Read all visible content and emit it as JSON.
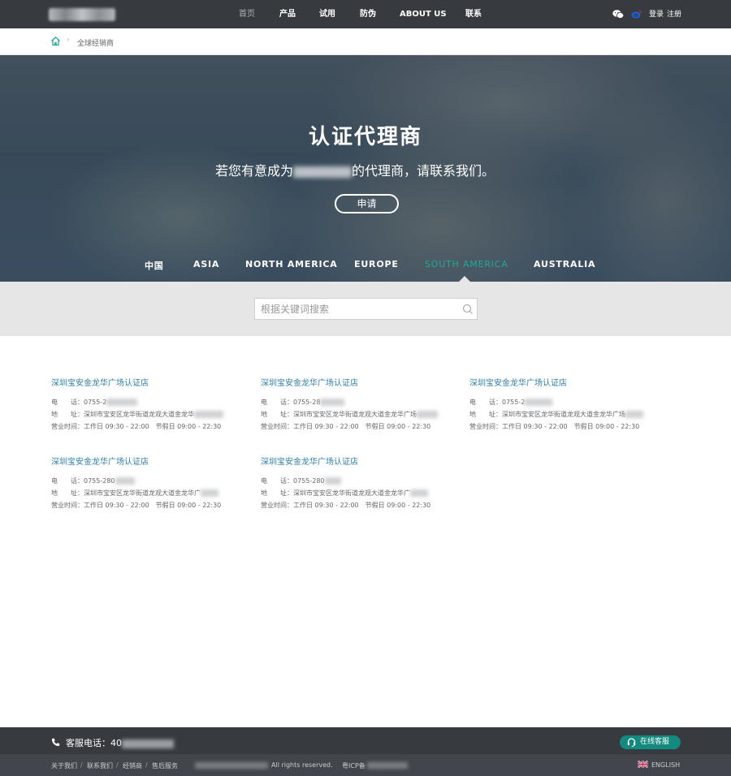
{
  "colors": {
    "topbar": "#373b40",
    "accent": "#1fa89a",
    "link": "#2e7ea6",
    "online_button": "#138a80"
  },
  "nav": {
    "items": [
      "首页",
      "产品",
      "试用",
      "防伪",
      "ABOUT US",
      "联系"
    ],
    "login": "登录",
    "register": "注册",
    "icons": [
      "wechat-icon",
      "weibo-icon"
    ]
  },
  "breadcrumb": {
    "current": "全球经销商",
    "icon": "home-icon"
  },
  "hero": {
    "title": "认证代理商",
    "subtitle_prefix": "若您有意成为",
    "subtitle_suffix": "的代理商，请联系我们。",
    "apply": "申请",
    "regions": [
      "中国",
      "ASIA",
      "NORTH AMERICA",
      "EUROPE",
      "SOUTH AMERICA",
      "AUSTRALIA"
    ],
    "active_region": "SOUTH AMERICA"
  },
  "search": {
    "placeholder": "根据关键词搜索",
    "value": ""
  },
  "dealers": [
    {
      "name": "深圳宝安金龙华广场认证店",
      "phone_label": "电　　话：",
      "phone": "0755-2",
      "addr_label": "地　　址：",
      "address": "深圳市宝安区龙华街道龙观大道金龙华",
      "hours_label": "营业时间：",
      "hours": "工作日 09:30 - 22:00　节假日 09:00 - 22:30"
    },
    {
      "name": "深圳宝安金龙华广场认证店",
      "phone_label": "电　　话：",
      "phone": "0755-28",
      "addr_label": "地　　址：",
      "address": "深圳市宝安区龙华街道龙观大道金龙华广场",
      "hours_label": "营业时间：",
      "hours": "工作日 09:30 - 22:00　节假日 09:00 - 22:30"
    },
    {
      "name": "深圳宝安金龙华广场认证店",
      "phone_label": "电　　话：",
      "phone": "0755-2",
      "addr_label": "地　　址：",
      "address": "深圳市宝安区龙华街道龙观大道金龙华广场",
      "hours_label": "营业时间：",
      "hours": "工作日 09:30 - 22:00　节假日 09:00 - 22:30"
    },
    {
      "name": "深圳宝安金龙华广场认证店",
      "phone_label": "电　　话：",
      "phone": "0755-280",
      "addr_label": "地　　址：",
      "address": "深圳市宝安区龙华街道龙观大道金龙华广",
      "hours_label": "营业时间：",
      "hours": "工作日 09:30 - 22:00　节假日 09:00 - 22:30"
    },
    {
      "name": "深圳宝安金龙华广场认证店",
      "phone_label": "电　　话：",
      "phone": "0755-280",
      "addr_label": "地　　址：",
      "address": "深圳市宝安区龙华街道龙观大道金龙华广",
      "hours_label": "营业时间：",
      "hours": "工作日 09:30 - 22:00　节假日 09:00 - 22:30"
    }
  ],
  "footer": {
    "hotline": "客服电话：40",
    "online_service": "在线客服",
    "links": [
      "关于我们",
      "联系我们",
      "经销商",
      "售后服务"
    ],
    "link_separator": "/",
    "rights": "All rights reserved.",
    "icp": "粤ICP备",
    "language": "ENGLISH",
    "icons": [
      "phone-icon",
      "headset-icon",
      "uk-flag-icon"
    ]
  }
}
